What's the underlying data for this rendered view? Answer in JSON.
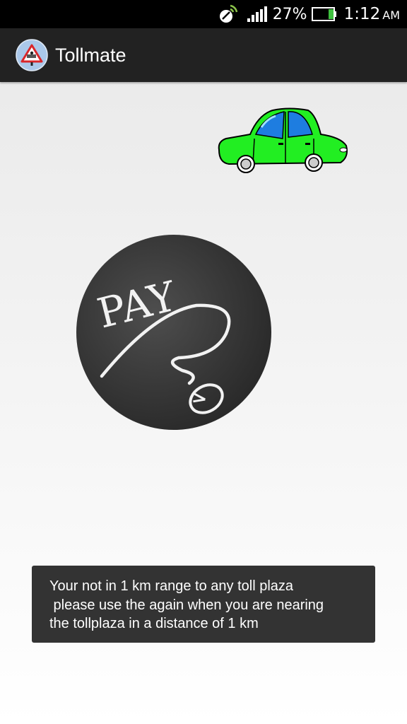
{
  "status_bar": {
    "icons": [
      "satellite-gps-icon",
      "signal-strength-icon",
      "battery-icon"
    ],
    "battery_percent": "27%",
    "time": "1:12",
    "meridiem": "AM",
    "colors": {
      "gps_active": "#8bc34a",
      "battery_level": "#3fc03f"
    }
  },
  "action_bar": {
    "app_icon": "toll-warning-sign-icon",
    "title": "Tollmate"
  },
  "images": {
    "car": "green-car-illustration",
    "pay": "chalkboard-pay-with-mouse-illustration",
    "pay_text": "PAY"
  },
  "toast": {
    "message": "Your not in 1 km range to any toll plaza\n please use the again when you are nearing\nthe tollplaza in a distance of 1 km"
  }
}
